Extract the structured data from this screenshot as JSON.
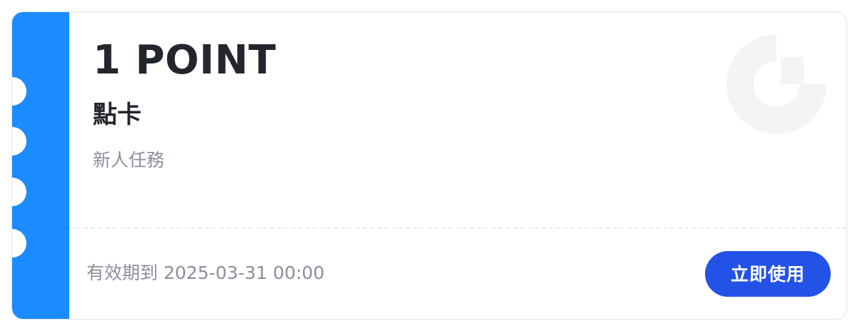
{
  "coupon": {
    "points": "1 POINT",
    "name": "點卡",
    "source": "新人任務",
    "expiry": "有效期到 2025-03-31 00:00",
    "use_button": "立即使用",
    "logo_icon": "brand-g-icon"
  },
  "colors": {
    "stub": "#1a8cff",
    "button": "#2352e6",
    "title": "#24262d",
    "muted": "#8a8f99",
    "logo": "#f3f4f6"
  }
}
